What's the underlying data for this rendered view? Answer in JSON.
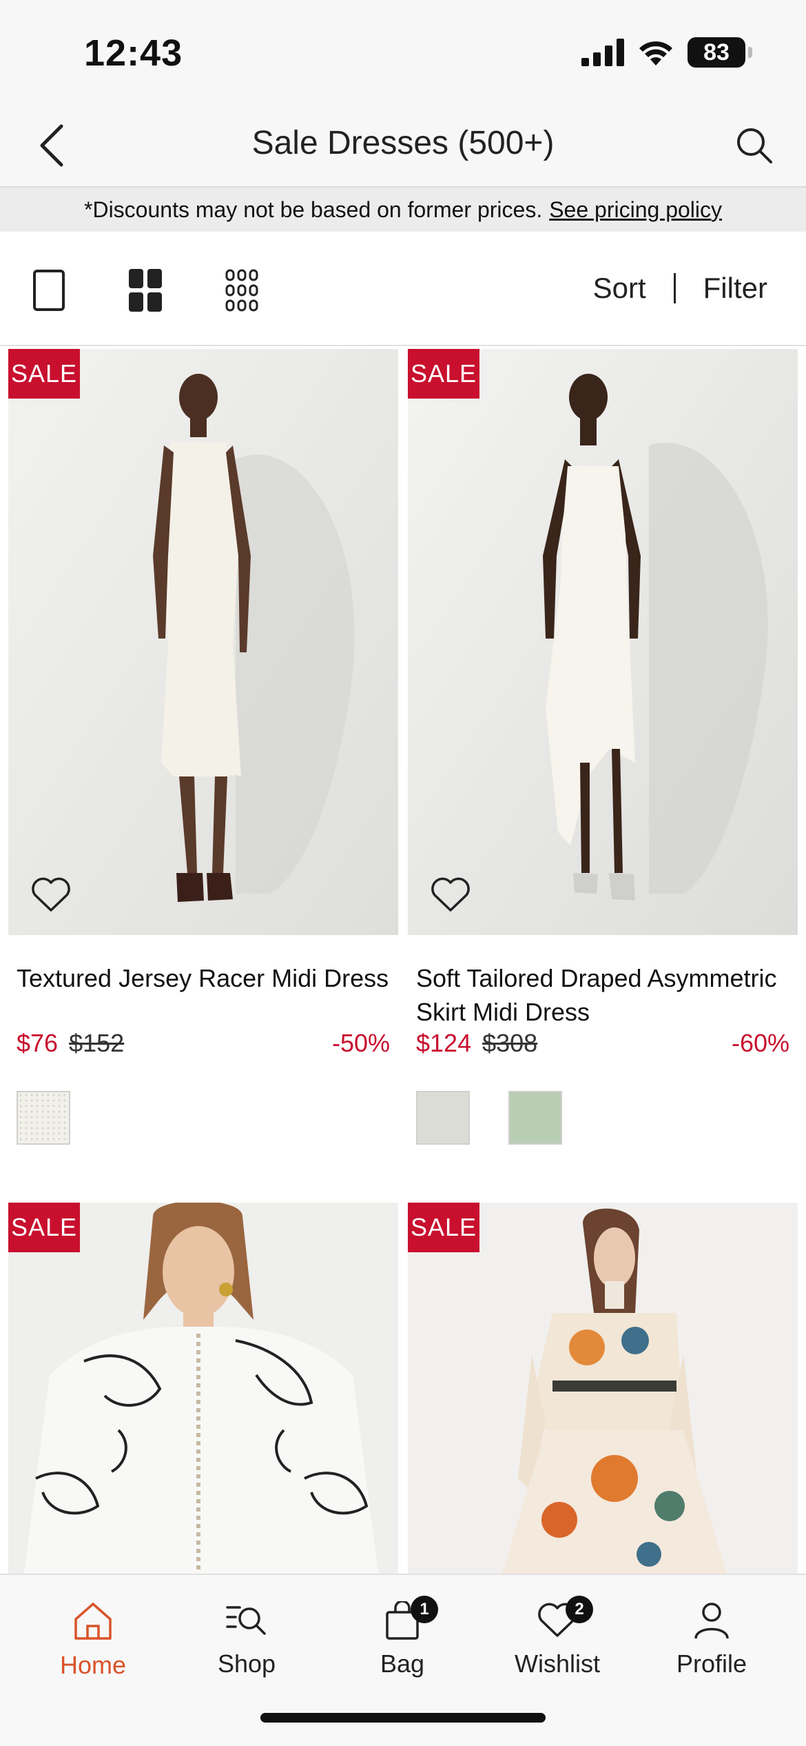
{
  "status_bar": {
    "time": "12:43",
    "battery": "83"
  },
  "header": {
    "title": "Sale Dresses (500+)",
    "back_icon": "chevron-left-icon",
    "search_icon": "search-icon"
  },
  "disclaimer": {
    "text": "*Discounts may not be based on former prices.",
    "link": "See pricing policy"
  },
  "toolbar": {
    "views": [
      "single-column-icon",
      "two-column-icon",
      "three-column-icon"
    ],
    "active_view": "two-column-icon",
    "sort_label": "Sort",
    "filter_label": "Filter"
  },
  "products": [
    {
      "badge": "SALE",
      "name": "Textured Jersey Racer Midi Dress",
      "price_now": "$76",
      "price_was": "$152",
      "discount": "-50%",
      "swatch_colors": [
        "#f1f0ea"
      ]
    },
    {
      "badge": "SALE",
      "name": "Soft Tailored Draped Asymmetric Skirt Midi Dress",
      "price_now": "$124",
      "price_was": "$308",
      "discount": "-60%",
      "swatch_colors": [
        "#dcdcd6",
        "#b9cdb4"
      ]
    },
    {
      "badge": "SALE"
    },
    {
      "badge": "SALE"
    }
  ],
  "tab_bar": {
    "tabs": [
      {
        "label": "Home",
        "icon": "home-icon",
        "active": true
      },
      {
        "label": "Shop",
        "icon": "shop-search-icon"
      },
      {
        "label": "Bag",
        "icon": "bag-icon",
        "badge": "1"
      },
      {
        "label": "Wishlist",
        "icon": "heart-icon",
        "badge": "2"
      },
      {
        "label": "Profile",
        "icon": "profile-icon"
      }
    ]
  },
  "colors": {
    "accent_red": "#c8102e",
    "active_tab": "#d9532a"
  }
}
